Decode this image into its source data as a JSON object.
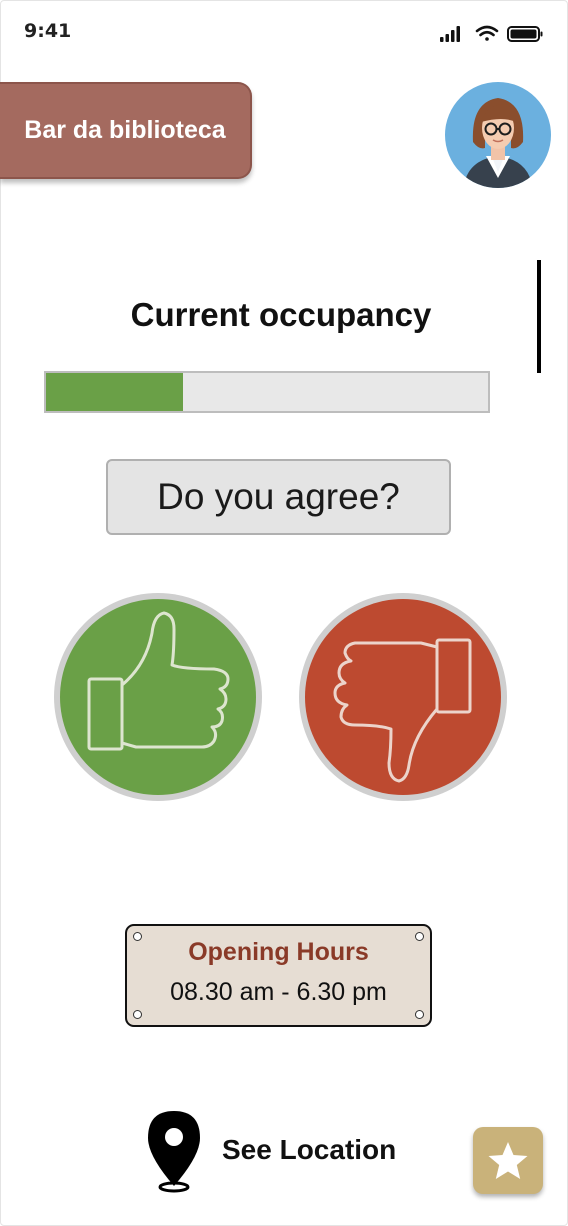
{
  "status_bar": {
    "time": "9:41"
  },
  "header": {
    "title": "Bar da biblioteca"
  },
  "occupancy": {
    "label": "Current occupancy",
    "level_fraction": 0.31,
    "fill_color": "#6aa047"
  },
  "vote": {
    "question": "Do you agree?",
    "agree_color": "#6aa047",
    "disagree_color": "#bd4a30"
  },
  "opening_hours": {
    "title": "Opening Hours",
    "value": "08.30 am - 6.30 pm"
  },
  "footer": {
    "location_label": "See Location"
  },
  "colors": {
    "title_button": "#a46a5f",
    "favorite_button": "#c9b27a"
  },
  "icons": {
    "profile": "user-avatar",
    "agree": "thumbs-up-icon",
    "disagree": "thumbs-down-icon",
    "location": "map-pin-icon",
    "favorite": "star-icon"
  }
}
